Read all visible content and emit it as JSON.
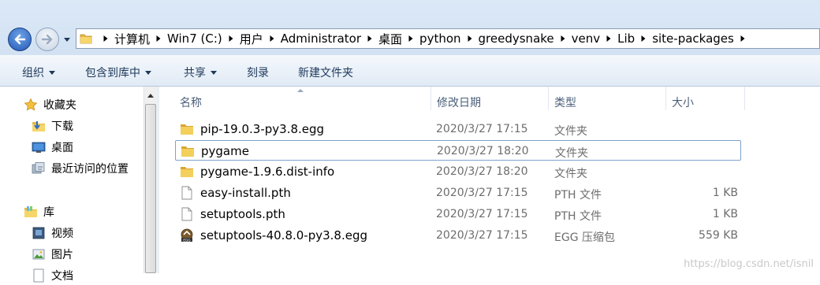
{
  "address": {
    "breadcrumbs": [
      "计算机",
      "Win7 (C:)",
      "用户",
      "Administrator",
      "桌面",
      "python",
      "greedysnake",
      "venv",
      "Lib",
      "site-packages"
    ]
  },
  "toolbar": {
    "organize": "组织",
    "include_in_library": "包含到库中",
    "share": "共享",
    "burn": "刻录",
    "new_folder": "新建文件夹"
  },
  "nav": {
    "favorites": "收藏夹",
    "downloads": "下载",
    "desktop": "桌面",
    "recent": "最近访问的位置",
    "libraries": "库",
    "videos": "视频",
    "pictures": "图片",
    "documents_partial": "文档"
  },
  "columns": {
    "name": "名称",
    "date": "修改日期",
    "type": "类型",
    "size": "大小"
  },
  "files": [
    {
      "name": "pip-19.0.3-py3.8.egg",
      "date": "2020/3/27 17:15",
      "type": "文件夹",
      "size": "",
      "icon": "folder-icon"
    },
    {
      "name": "pygame",
      "date": "2020/3/27 18:20",
      "type": "文件夹",
      "size": "",
      "icon": "folder-icon",
      "selected": true
    },
    {
      "name": "pygame-1.9.6.dist-info",
      "date": "2020/3/27 18:20",
      "type": "文件夹",
      "size": "",
      "icon": "folder-icon"
    },
    {
      "name": "easy-install.pth",
      "date": "2020/3/27 17:15",
      "type": "PTH 文件",
      "size": "1 KB",
      "icon": "file-icon"
    },
    {
      "name": "setuptools.pth",
      "date": "2020/3/27 17:15",
      "type": "PTH 文件",
      "size": "1 KB",
      "icon": "file-icon"
    },
    {
      "name": "setuptools-40.8.0-py3.8.egg",
      "date": "2020/3/27 17:15",
      "type": "EGG 压缩包",
      "size": "559 KB",
      "icon": "egg-archive-icon"
    }
  ],
  "watermark": "https://blog.csdn.net/isnil",
  "colors": {
    "accent": "#1e395b",
    "selection_border": "#7da2ce",
    "folder": "#e8b93e"
  }
}
